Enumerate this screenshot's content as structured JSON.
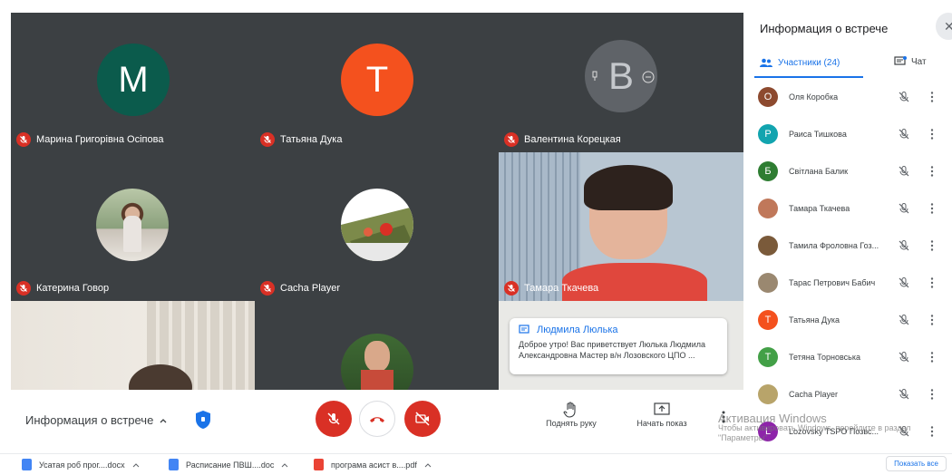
{
  "tiles": {
    "t1": {
      "initial": "M",
      "color": "#0b5b4c",
      "name": "Марина Григорівна Осіпова"
    },
    "t2": {
      "initial": "T",
      "color": "#f4511e",
      "name": "Татьяна Дука"
    },
    "t3": {
      "initial": "B",
      "color": "#5f6368",
      "name": "Валентина Корецкая"
    },
    "t4": {
      "name": "Катерина Говор"
    },
    "t5": {
      "name": "Cacha Player"
    },
    "t6": {
      "name": "Тамара Ткачева"
    }
  },
  "toast": {
    "sender": "Людмила Люлька",
    "message": "Доброе утро! Вас приветствует Люлька Людмила Александровна Мастер в/н Лозовского ЦПО ..."
  },
  "controls": {
    "meeting_info": "Информация о встрече",
    "raise_hand": "Поднять руку",
    "present": "Начать показ"
  },
  "downloads": [
    {
      "name": "Усатая роб прог....docx",
      "color": "#4285f4"
    },
    {
      "name": "Расписание ПВШ....doc",
      "color": "#4285f4"
    },
    {
      "name": "програма асист в....pdf",
      "color": "#ea4335"
    }
  ],
  "show_all": "Показать все",
  "panel": {
    "title": "Информация о встрече",
    "people_tab": "Участники (24)",
    "chat_tab": "Чат",
    "participants": [
      {
        "name": "Оля Коробка",
        "initial": "О",
        "color": "#8d4a2f"
      },
      {
        "name": "Раиса Тишкова",
        "initial": "Р",
        "color": "#12a4af"
      },
      {
        "name": "Світлана Балик",
        "initial": "Б",
        "color": "#2e7d32"
      },
      {
        "name": "Тамара Ткачева",
        "initial": "",
        "color": "#c0785a"
      },
      {
        "name": "Тамила Фроловна Гоз...",
        "initial": "",
        "color": "#7a5a3a"
      },
      {
        "name": "Тарас Петрович Бабич",
        "initial": "",
        "color": "#9a8870"
      },
      {
        "name": "Татьяна Дука",
        "initial": "Т",
        "color": "#f4511e"
      },
      {
        "name": "Тетяна Торновська",
        "initial": "Т",
        "color": "#43a047"
      },
      {
        "name": "Cacha Player",
        "initial": "",
        "color": "#b8a46a"
      },
      {
        "name": "Lozovsky TSPO Позвс...",
        "initial": "L",
        "color": "#8e24aa"
      }
    ]
  },
  "watermark": {
    "line1": "Активация Windows",
    "line2": "Чтобы активировать Windows, перейдите в раздел",
    "line3": "\"Параметры\"."
  },
  "colors": {
    "accent": "#1a73e8",
    "danger": "#d93025",
    "grid_bg": "#202124",
    "tile_bg": "#3c4043"
  }
}
